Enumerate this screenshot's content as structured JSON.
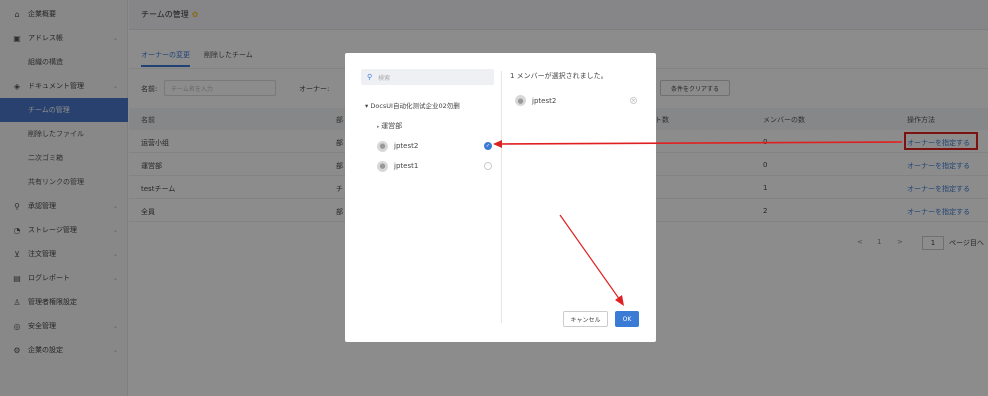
{
  "sidebar": {
    "items": [
      {
        "label": "企業概要",
        "icon": "home-icon",
        "glyph": "⌂",
        "chevron": false
      },
      {
        "label": "アドレス帳",
        "icon": "address-book-icon",
        "glyph": "▣",
        "chevron": true
      },
      {
        "label": "組織の構造",
        "sub": true
      },
      {
        "label": "ドキュメント管理",
        "icon": "document-icon",
        "glyph": "◈",
        "chevron": true
      },
      {
        "label": "チームの管理",
        "sub": true,
        "active": true
      },
      {
        "label": "削除したファイル",
        "sub": true
      },
      {
        "label": "二次ゴミ箱",
        "sub": true
      },
      {
        "label": "共有リンクの管理",
        "sub": true
      },
      {
        "label": "承認管理",
        "icon": "approval-icon",
        "glyph": "⚲",
        "chevron": true
      },
      {
        "label": "ストレージ管理",
        "icon": "storage-icon",
        "glyph": "◔",
        "chevron": true
      },
      {
        "label": "注文管理",
        "icon": "cart-icon",
        "glyph": "⊻",
        "chevron": true
      },
      {
        "label": "ログレポート",
        "icon": "log-icon",
        "glyph": "▤",
        "chevron": true
      },
      {
        "label": "管理者権限設定",
        "icon": "admin-icon",
        "glyph": "♙",
        "chevron": false
      },
      {
        "label": "安全管理",
        "icon": "shield-icon",
        "glyph": "◎",
        "chevron": true
      },
      {
        "label": "企業の設定",
        "icon": "gear-icon",
        "glyph": "⚙",
        "chevron": true
      }
    ]
  },
  "header": {
    "title": "チームの管理",
    "star": "✿"
  },
  "tabs": [
    {
      "label": "オーナーの変更",
      "active": true
    },
    {
      "label": "削除したチーム",
      "active": false
    }
  ],
  "filters": {
    "name_label": "名前:",
    "name_placeholder": "チーム名を入力",
    "owner_label": "オーナー:",
    "clear_button": "条件をクリアする"
  },
  "table": {
    "columns": [
      "名前",
      "部",
      "ト数",
      "メンバーの数",
      "操作方法"
    ],
    "rows": [
      {
        "name": "运营小组",
        "dept": "部",
        "members": "0",
        "action": "オーナーを指定する"
      },
      {
        "name": "運営部",
        "dept": "部",
        "members": "0",
        "action": "オーナーを指定する"
      },
      {
        "name": "testチーム",
        "dept": "チ",
        "members": "1",
        "action": "オーナーを指定する"
      },
      {
        "name": "全員",
        "dept": "部",
        "members": "2",
        "action": "オーナーを指定する"
      }
    ]
  },
  "pager": {
    "prev": "<",
    "current": "1",
    "next": ">",
    "input": "1",
    "suffix": "ページ目へ"
  },
  "modal": {
    "search_placeholder": "検索",
    "search_icon": "search-icon",
    "tree_root": "DocsUI自动化测试企业02勿删",
    "department": "運営部",
    "members": [
      {
        "name": "jptest2",
        "checked": true
      },
      {
        "name": "jptest1",
        "checked": false
      }
    ],
    "selected_header": "1 メンバーが選択されました。",
    "selected": [
      "jptest2"
    ],
    "cancel_label": "キャンセル",
    "ok_label": "OK"
  },
  "colors": {
    "accent": "#3a7bd5",
    "annotation": "#e02020",
    "sidebar_active": "#4a77c9"
  }
}
